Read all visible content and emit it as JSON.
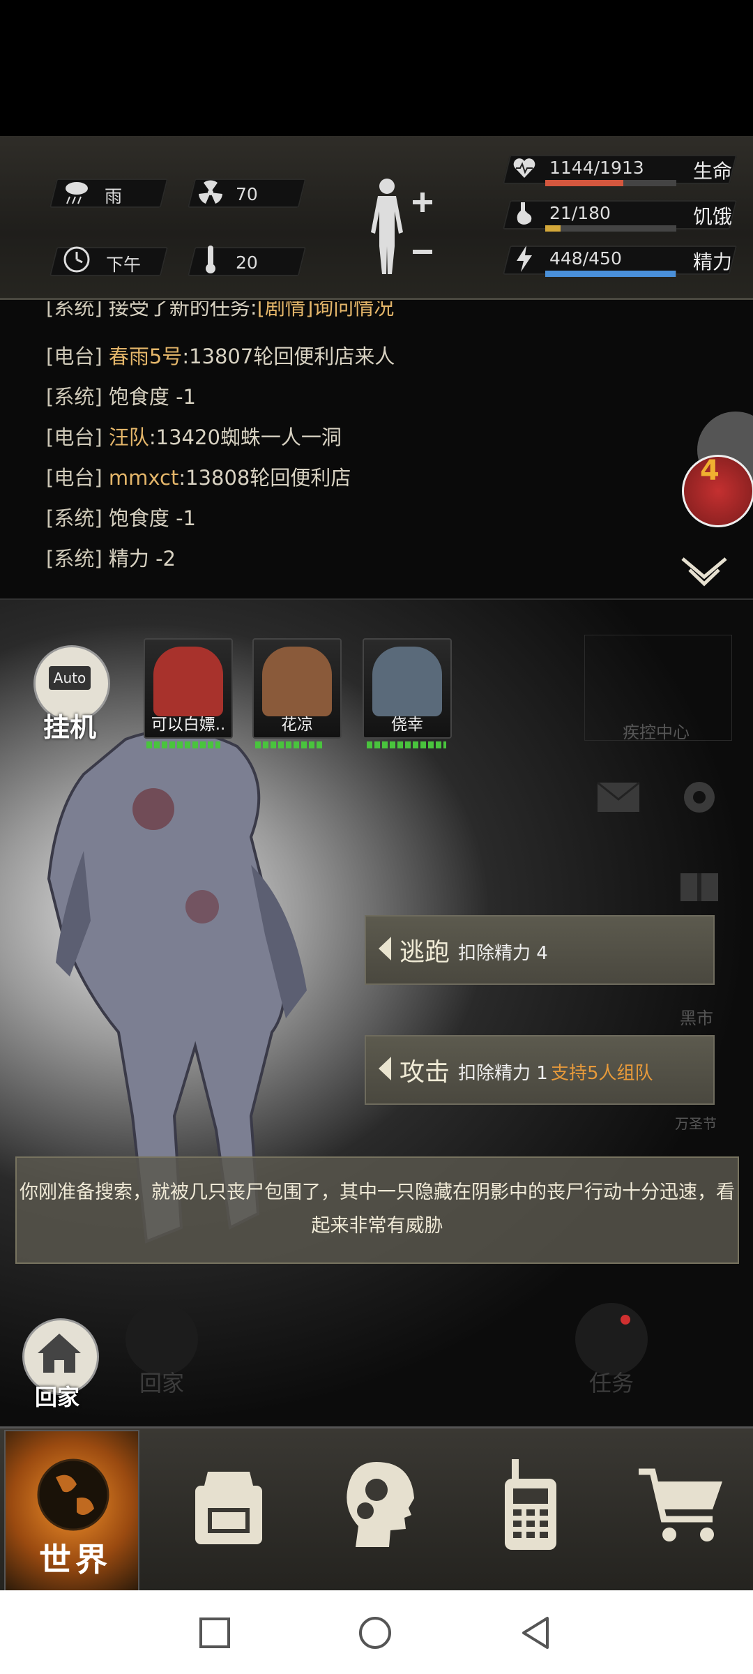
{
  "stats": {
    "weather": "雨",
    "radiation": "70",
    "time_of_day": "下午",
    "temperature": "20",
    "life_value": "1144/1913",
    "life_label": "生命",
    "life_fraction": 0.598,
    "hunger_value": "21/180",
    "hunger_label": "饥饿",
    "hunger_fraction": 0.117,
    "energy_value": "448/450",
    "energy_label": "精力",
    "energy_fraction": 0.996
  },
  "log": [
    {
      "src": "[系统]",
      "pre": "接受了新的任务:",
      "hl": "[剧情]询问情况",
      "rest": ""
    },
    {
      "src": "[电台]",
      "pre": "",
      "hl": "春雨5号",
      "rest": ":13807轮回便利店来人"
    },
    {
      "src": "[系统]",
      "pre": "饱食度 -1",
      "hl": "",
      "rest": ""
    },
    {
      "src": "[电台]",
      "pre": "",
      "hl": "汪队",
      "rest": ":13420蜘蛛一人一洞"
    },
    {
      "src": "[电台]",
      "pre": "",
      "hl": "mmxct",
      "rest": ":13808轮回便利店"
    },
    {
      "src": "[系统]",
      "pre": "饱食度 -1",
      "hl": "",
      "rest": ""
    },
    {
      "src": "[系统]",
      "pre": "精力 -2",
      "hl": "",
      "rest": ""
    }
  ],
  "floating_badge": "4",
  "auto": {
    "badge": "Auto",
    "label": "挂机"
  },
  "party": [
    {
      "name": "可以白嫖..",
      "color": "#a8322c"
    },
    {
      "name": "花凉",
      "color": "#8a5a3a"
    },
    {
      "name": "侥幸",
      "color": "#5a6a7a"
    }
  ],
  "side": {
    "control_center": "疾控中心",
    "black_market": "黑市",
    "halloween": "万圣节"
  },
  "actions": {
    "flee_title": "逃跑",
    "flee_desc": "扣除精力 4",
    "attack_title": "攻击",
    "attack_desc": "扣除精力 1",
    "attack_extra": "支持5人组队"
  },
  "message": "你刚准备搜索，就被几只丧尸包围了，其中一只隐藏在阴影中的丧尸行动十分迅速，看起来非常有威胁",
  "home_label": "回家",
  "home_label_ghost": "回家",
  "task_label": "任务",
  "nav": {
    "world": "世界"
  },
  "colors": {
    "life": "#d4573e",
    "hunger": "#d4a83a",
    "energy": "#4a90d9",
    "accent": "#e08a2a"
  }
}
